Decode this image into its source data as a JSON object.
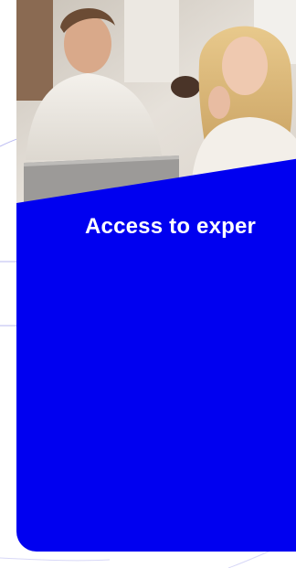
{
  "card": {
    "title": "Access to exper",
    "background_color": "#0000f0",
    "title_color": "#ffffff"
  },
  "photo": {
    "description_icon": "photo-image"
  },
  "colors": {
    "page_background": "#ffffff",
    "decor_line": "#b9b9f2"
  }
}
